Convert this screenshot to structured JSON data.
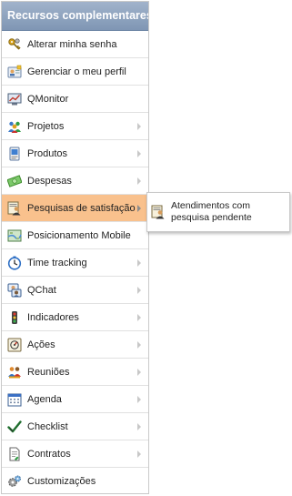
{
  "menu": {
    "title": "Recursos complementares",
    "items": [
      {
        "label": "Alterar minha senha",
        "icon": "keys-icon",
        "arrow": false
      },
      {
        "label": "Gerenciar o meu perfil",
        "icon": "profile-card-icon",
        "arrow": false
      },
      {
        "label": "QMonitor",
        "icon": "monitor-chart-icon",
        "arrow": false
      },
      {
        "label": "Projetos",
        "icon": "people-group-icon",
        "arrow": true
      },
      {
        "label": "Produtos",
        "icon": "product-box-icon",
        "arrow": true
      },
      {
        "label": "Despesas",
        "icon": "money-icon",
        "arrow": true
      },
      {
        "label": "Pesquisas de satisfação",
        "icon": "survey-person-icon",
        "arrow": true,
        "active": true
      },
      {
        "label": "Posicionamento Mobile",
        "icon": "map-icon",
        "arrow": false
      },
      {
        "label": "Time tracking",
        "icon": "clock-icon",
        "arrow": true
      },
      {
        "label": "QChat",
        "icon": "chat-icon",
        "arrow": true
      },
      {
        "label": "Indicadores",
        "icon": "traffic-light-icon",
        "arrow": true
      },
      {
        "label": "Ações",
        "icon": "action-target-icon",
        "arrow": true
      },
      {
        "label": "Reuniões",
        "icon": "meeting-people-icon",
        "arrow": true
      },
      {
        "label": "Agenda",
        "icon": "calendar-icon",
        "arrow": true
      },
      {
        "label": "Checklist",
        "icon": "checkmark-icon",
        "arrow": true
      },
      {
        "label": "Contratos",
        "icon": "document-icon",
        "arrow": true
      },
      {
        "label": "Customizações",
        "icon": "gears-icon",
        "arrow": false
      }
    ]
  },
  "submenu": {
    "items": [
      {
        "label": "Atendimentos com pesquisa pendente",
        "icon": "survey-person-icon"
      }
    ]
  },
  "colors": {
    "header_start": "#a1b3cb",
    "header_end": "#7f96b4",
    "active_bg": "#f9c18d"
  }
}
